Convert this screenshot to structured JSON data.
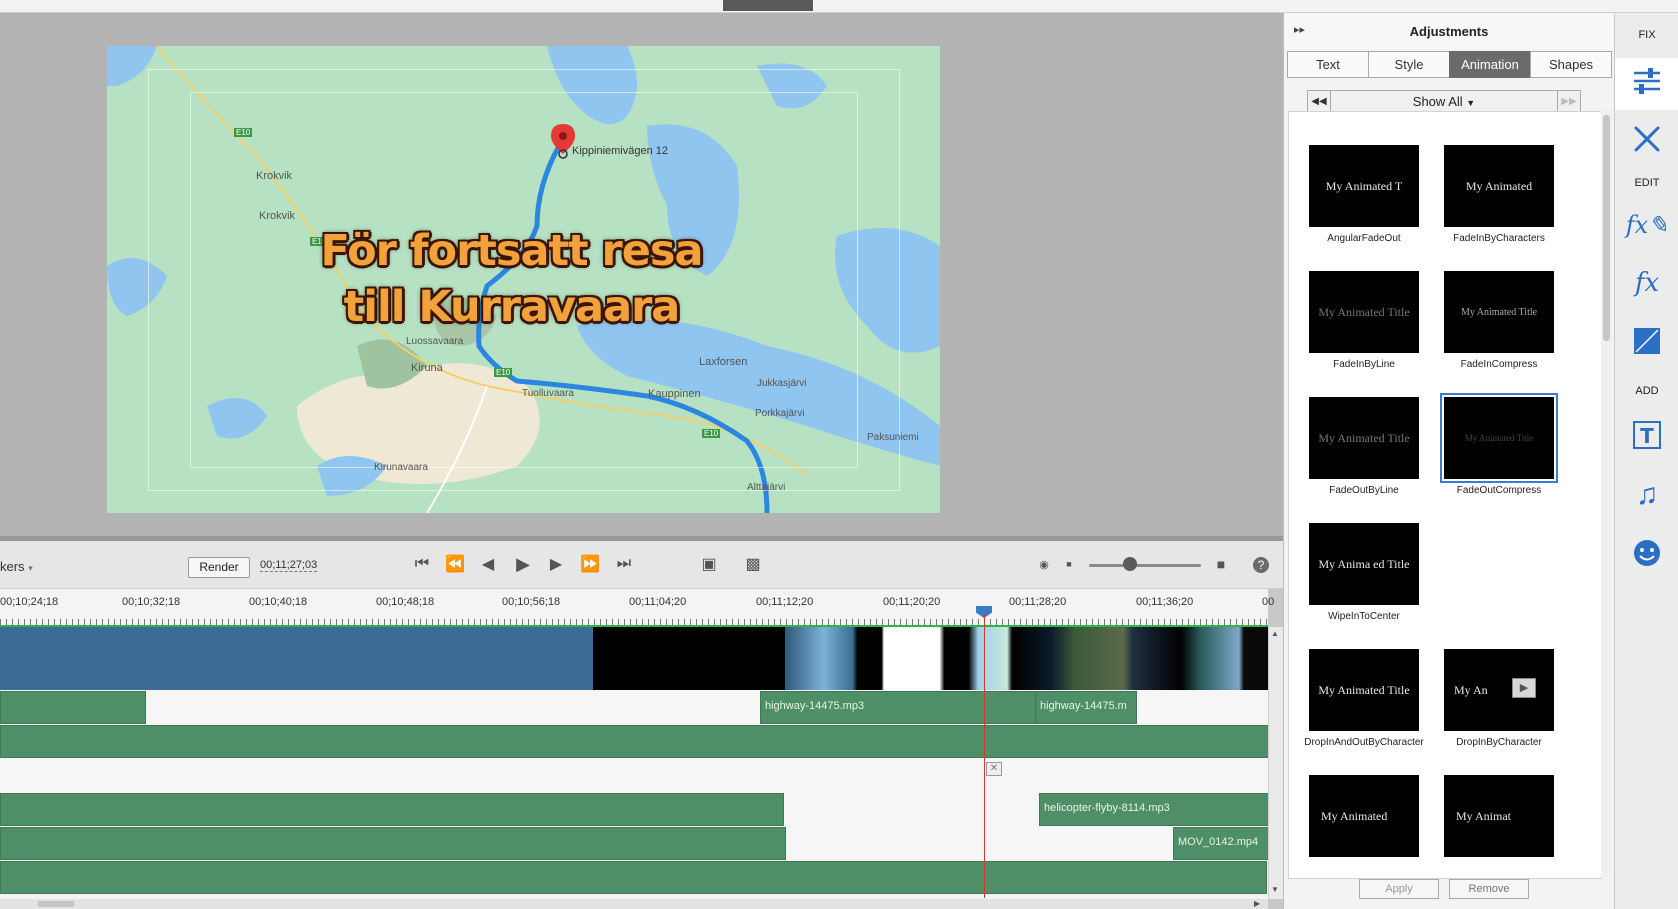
{
  "preview": {
    "title_line1": "För fortsatt resa",
    "title_line2": "till Kurravaara",
    "map_labels": [
      {
        "text": "Kippiniemivägen 12"
      },
      {
        "text": "Krokvik"
      },
      {
        "text": "Krokvik"
      },
      {
        "text": "Luossavaara"
      },
      {
        "text": "Kiruna"
      },
      {
        "text": "Tuolluvaara"
      },
      {
        "text": "Kauppinen"
      },
      {
        "text": "Laxforsen"
      },
      {
        "text": "Jukkasjärvi"
      },
      {
        "text": "Porkkajärvi"
      },
      {
        "text": "Paksuniemi"
      },
      {
        "text": "Kirunavaara"
      },
      {
        "text": "Alttajärvi"
      },
      {
        "text": "E10"
      },
      {
        "text": "E10"
      },
      {
        "text": "E10"
      },
      {
        "text": "E10"
      }
    ],
    "colors": {
      "map_bg": "#b6e2c3",
      "water": "#8fc5ef",
      "route": "#2a86de",
      "title": "#f2a23a"
    }
  },
  "timeline": {
    "markers_label": "kers",
    "render_label": "Render",
    "timecode": "00;11;27;03",
    "ruler_ticks": [
      "00;10;24;18",
      "00;10;32;18",
      "00;10;40;18",
      "00;10;48;18",
      "00;10;56;18",
      "00;11;04;20",
      "00;11;12;20",
      "00;11;20;20",
      "00;11;28;20",
      "00;11;36;20",
      "00"
    ],
    "clips": {
      "audio1a": "highway-14475.mp3",
      "audio1b": "highway-14475.m",
      "audio3": "helicopter-flyby-8114.mp3",
      "video4": "MOV_0142.mp4"
    },
    "playhead_color": "#d23a2a"
  },
  "panel": {
    "title": "Adjustments",
    "tabs": [
      {
        "label": "Text"
      },
      {
        "label": "Style"
      },
      {
        "label": "Animation"
      },
      {
        "label": "Shapes"
      }
    ],
    "filter": "Show All",
    "presets": [
      {
        "thumb": "My Animated T",
        "name": "AngularFadeOut"
      },
      {
        "thumb": "My Animated",
        "name": "FadeInByCharacters"
      },
      {
        "thumb": "My Animated Title",
        "name": "FadeInByLine"
      },
      {
        "thumb": "My Animated Title",
        "name": "FadeInCompress"
      },
      {
        "thumb": "My Animated Title",
        "name": "FadeOutByLine"
      },
      {
        "thumb": "My Animated Title",
        "name": "FadeOutCompress"
      },
      {
        "thumb": "My Anima ed Title",
        "name": "WipeInToCenter"
      },
      {
        "thumb": "My Animated Title",
        "name": "DropInAndOutByCharacter"
      },
      {
        "thumb": "My An",
        "name": "DropInByCharacter"
      },
      {
        "thumb": "My Animated",
        "name": ""
      },
      {
        "thumb": "My Animat",
        "name": ""
      }
    ],
    "apply_label": "Apply",
    "remove_label": "Remove",
    "accent": "#3a7bd5"
  },
  "sidebar": {
    "fix_label": "FIX",
    "edit_label": "EDIT",
    "add_label": "ADD",
    "icon_color": "#2a6fc4"
  }
}
